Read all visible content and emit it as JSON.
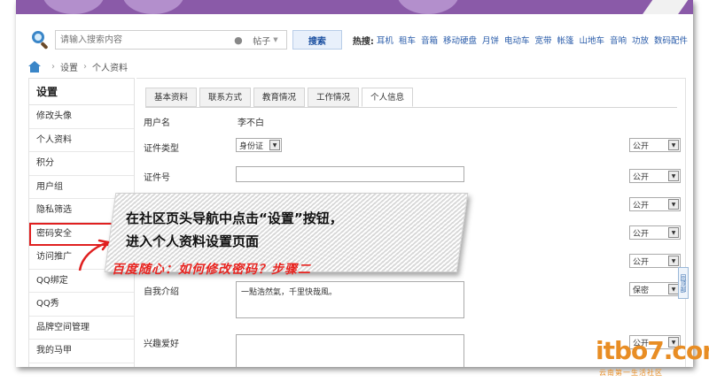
{
  "search": {
    "placeholder": "请输入搜索内容",
    "type_label": "帖子",
    "button_label": "搜索",
    "hot_label": "热搜:",
    "hot_words": [
      "耳机",
      "租车",
      "音箱",
      "移动硬盘",
      "月饼",
      "电动车",
      "宽带",
      "帐篷",
      "山地车",
      "音响",
      "功放",
      "数码配件"
    ]
  },
  "breadcrumb": {
    "items": [
      "设置",
      "个人资料"
    ]
  },
  "sidebar": {
    "title": "设置",
    "items": [
      {
        "label": "修改头像"
      },
      {
        "label": "个人资料"
      },
      {
        "label": "积分"
      },
      {
        "label": "用户组"
      },
      {
        "label": "隐私筛选"
      },
      {
        "label": "密码安全"
      },
      {
        "label": "访问推广"
      },
      {
        "label": "QQ绑定"
      },
      {
        "label": "QQ秀"
      },
      {
        "label": "品牌空间管理"
      },
      {
        "label": "我的马甲"
      }
    ]
  },
  "tabs": [
    "基本资料",
    "联系方式",
    "教育情况",
    "工作情况",
    "个人信息"
  ],
  "active_tab": "个人信息",
  "form": {
    "username_label": "用户名",
    "username_value": "李不白",
    "id_type_label": "证件类型",
    "id_type_value": "身份证",
    "id_number_label": "证件号",
    "bio_label": "自我介绍",
    "bio_value": "一點浩然氣，千里快哉風。",
    "hobby_label": "兴趣爱好",
    "privacy_public": "公开",
    "privacy_secret": "保密"
  },
  "annotation": {
    "line1": "在社区页头导航中点击“设置”按钮，",
    "line2": "进入个人资料设置页面",
    "subtitle": "百度随心：如何修改密码？步骤二"
  },
  "side_tab_label": "回顶部",
  "watermark": {
    "main": "itbo7.com",
    "sub": "云南第一生活社区"
  },
  "colors": {
    "banner": "#8a5aa8",
    "highlight": "#e02020",
    "link": "#2a5caa",
    "watermark": "#e88d24"
  }
}
